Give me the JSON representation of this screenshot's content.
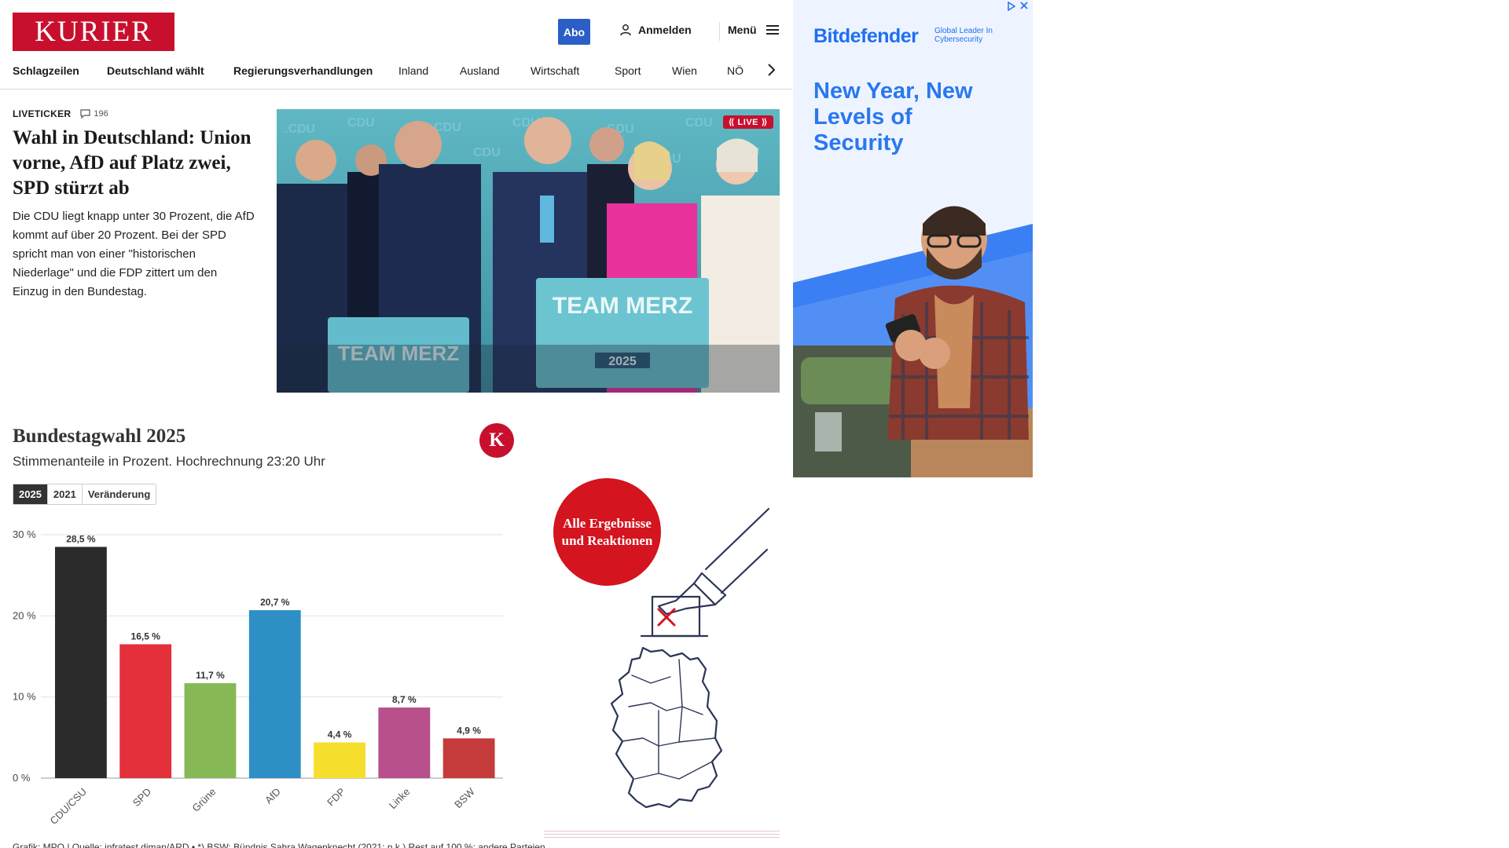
{
  "header": {
    "logo": "KURIER",
    "abo_label": "Abo",
    "login_label": "Anmelden",
    "menu_label": "Menü",
    "nav": [
      "Schlagzeilen",
      "Deutschland wählt",
      "Regierungsverhandlungen",
      "Inland",
      "Ausland",
      "Wirtschaft",
      "Sport",
      "Wien",
      "NÖ"
    ]
  },
  "lead": {
    "label": "LIVETICKER",
    "comments": "196",
    "headline": "Wahl in Deutschland: Union vorne, AfD auf Platz zwei, SPD stürzt ab",
    "teaser": "Die CDU liegt knapp unter 30 Prozent, die AfD kommt auf über 20 Prozent. Bei der SPD spricht man von einer \"historischen Niederlage\" und die FDP zittert um den Einzug in den Bundestag.",
    "live_badge": "⟪ LIVE ⟫",
    "photo_sign_1": "TEAM MERZ",
    "photo_sign_year": "2025",
    "photo_sign_2": "TEAM MERZ"
  },
  "chart_widget": {
    "title": "Bundestagwahl 2025",
    "subtitle": "Stimmenanteile in Prozent. Hochrechnung 23:20 Uhr",
    "badge": "K",
    "tabs": [
      "2025",
      "2021",
      "Veränderung"
    ],
    "active_tab": "2025",
    "footer": "Grafik: MPO | Quelle: infratest dimap/ARD • *) BSW: Bündnis Sahra Wagenknecht (2021: n.k.) Rest auf 100 %: andere Parteien"
  },
  "chart_data": {
    "type": "bar",
    "categories": [
      "CDU/CSU",
      "SPD",
      "Grüne",
      "AfD",
      "FDP",
      "Linke",
      "BSW"
    ],
    "values": [
      28.5,
      16.5,
      11.7,
      20.7,
      4.4,
      8.7,
      4.9
    ],
    "data_labels": [
      "28,5 %",
      "16,5 %",
      "11,7 %",
      "20,7 %",
      "4,4 %",
      "8,7 %",
      "4,9 %"
    ],
    "colors": [
      "#2b2b2b",
      "#e3303b",
      "#86b855",
      "#2d8fc4",
      "#f6de2c",
      "#b8508d",
      "#c53b3b"
    ],
    "y_ticks": [
      "0 %",
      "10 %",
      "20 %",
      "30 %"
    ],
    "ylim": [
      0,
      30
    ],
    "grid": true
  },
  "promo": {
    "circle_text": "Alle Ergebnisse und Reaktionen"
  },
  "ad": {
    "brand": "Bitdefender",
    "tagline": "Global Leader In Cybersecurity",
    "headline": "New Year, New Levels of Security",
    "colors": {
      "accent": "#1f6ff0"
    }
  }
}
